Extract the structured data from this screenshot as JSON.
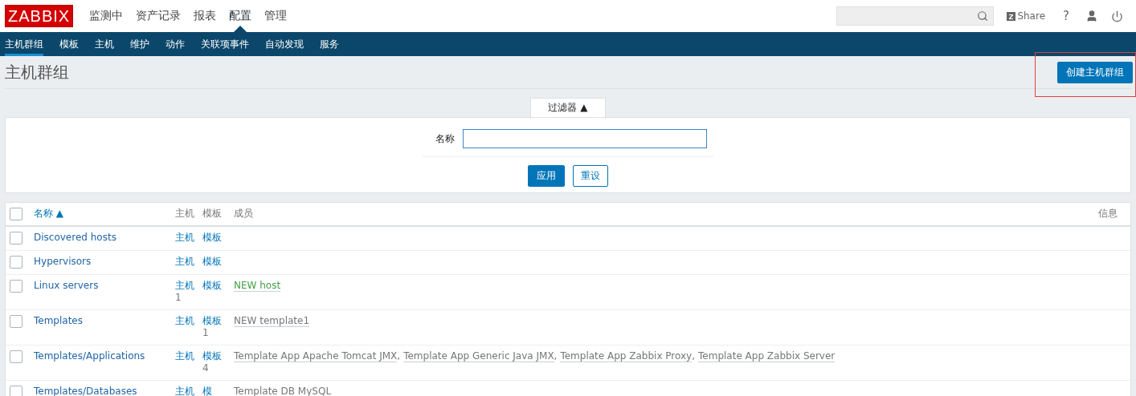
{
  "logo": "ZABBIX",
  "main_menu": [
    {
      "label": "监测中",
      "selected": false
    },
    {
      "label": "资产记录",
      "selected": false
    },
    {
      "label": "报表",
      "selected": false
    },
    {
      "label": "配置",
      "selected": true
    },
    {
      "label": "管理",
      "selected": false
    }
  ],
  "header_actions": {
    "share": "Share",
    "help": "?"
  },
  "sub_menu": [
    {
      "label": "主机群组",
      "selected": true
    },
    {
      "label": "模板",
      "selected": false
    },
    {
      "label": "主机",
      "selected": false
    },
    {
      "label": "维护",
      "selected": false
    },
    {
      "label": "动作",
      "selected": false
    },
    {
      "label": "关联项事件",
      "selected": false
    },
    {
      "label": "自动发现",
      "selected": false
    },
    {
      "label": "服务",
      "selected": false
    }
  ],
  "page_title": "主机群组",
  "create_button": "创建主机群组",
  "filter": {
    "tab_label": "过滤器 ▲",
    "name_label": "名称",
    "apply": "应用",
    "reset": "重设"
  },
  "table": {
    "select_all_checked": false,
    "columns": {
      "name": "名称 ▲",
      "hosts": "主机",
      "templates": "模板",
      "members": "成员",
      "info": "信息"
    },
    "rows": [
      {
        "name": "Discovered hosts",
        "hosts": "主机",
        "templates": "模板",
        "checked": false
      },
      {
        "name": "Hypervisors",
        "hosts": "主机",
        "templates": "模板",
        "checked": false
      },
      {
        "name": "Linux servers",
        "hosts": "主机",
        "hosts_count": "1",
        "templates": "模板",
        "checked": false,
        "members": [
          {
            "text": "NEW host",
            "kind": "host"
          }
        ]
      },
      {
        "name": "Templates",
        "hosts": "主机",
        "templates": "模板",
        "templates_count": "1",
        "checked": false,
        "members": [
          {
            "text": "NEW template1",
            "kind": "template"
          }
        ]
      },
      {
        "name": "Templates/Applications",
        "hosts": "主机",
        "templates": "模板",
        "templates_count": "4",
        "checked": false,
        "members": [
          {
            "text": "Template App Apache Tomcat JMX",
            "suffix": ",",
            "kind": "template"
          },
          {
            "text": "Template App Generic Java JMX",
            "suffix": ",",
            "kind": "template"
          },
          {
            "text": "Template App Zabbix Proxy",
            "suffix": ",",
            "kind": "template"
          },
          {
            "text": "Template App Zabbix Server",
            "kind": "template"
          }
        ]
      },
      {
        "name": "Templates/Databases",
        "hosts": "主机",
        "templates": "模",
        "checked": false,
        "members": [
          {
            "text": "Template DB MySQL",
            "kind": "plain"
          }
        ]
      }
    ]
  }
}
